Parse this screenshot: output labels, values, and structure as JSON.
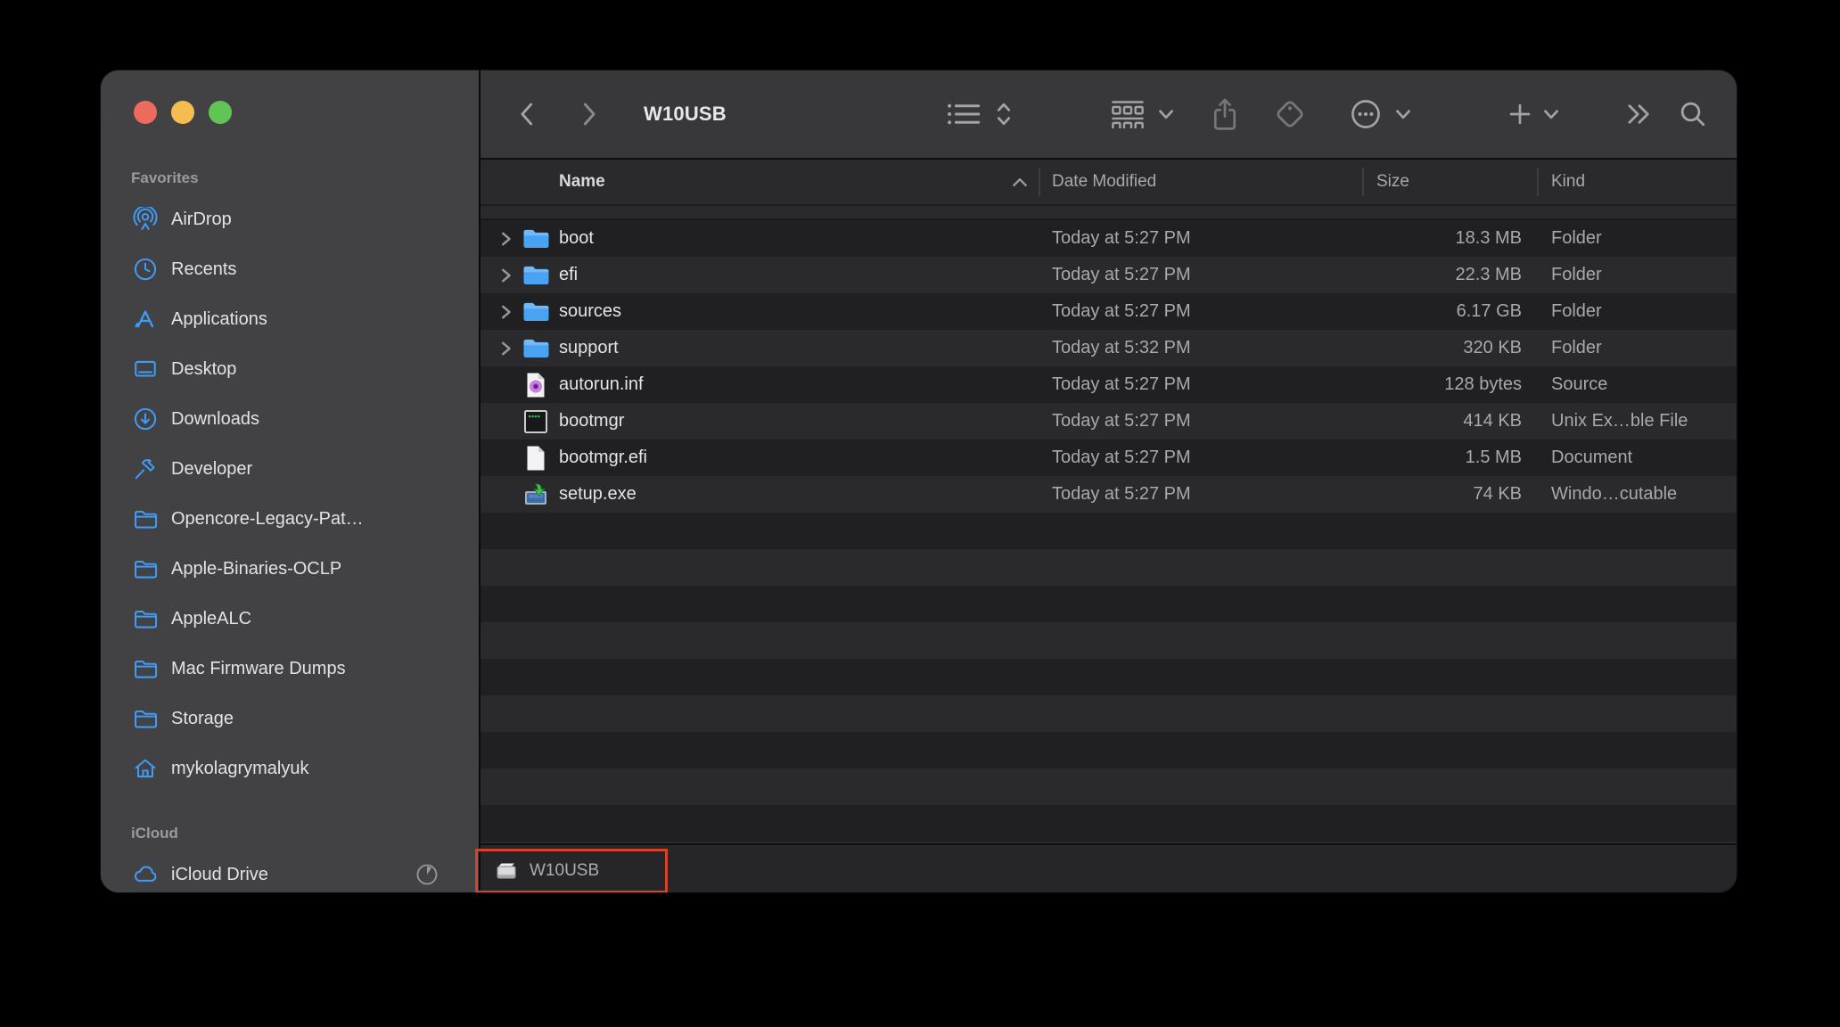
{
  "colors": {
    "accent_blue": "#3F9BF5",
    "annotation_red": "#D2442C",
    "traffic_red": "#ED6A5E",
    "traffic_yellow": "#F5BD4F",
    "traffic_green": "#61C454"
  },
  "window": {
    "title": "W10USB"
  },
  "toolbar": {
    "title": "W10USB"
  },
  "sidebar": {
    "sections": [
      {
        "label": "Favorites",
        "items": [
          {
            "label": "AirDrop",
            "icon": "airdrop"
          },
          {
            "label": "Recents",
            "icon": "clock"
          },
          {
            "label": "Applications",
            "icon": "app-store"
          },
          {
            "label": "Desktop",
            "icon": "desktop"
          },
          {
            "label": "Downloads",
            "icon": "download-circle"
          },
          {
            "label": "Developer",
            "icon": "hammer"
          },
          {
            "label": "Opencore-Legacy-Pat…",
            "icon": "folder"
          },
          {
            "label": "Apple-Binaries-OCLP",
            "icon": "folder"
          },
          {
            "label": "AppleALC",
            "icon": "folder"
          },
          {
            "label": "Mac Firmware Dumps",
            "icon": "folder"
          },
          {
            "label": "Storage",
            "icon": "folder"
          },
          {
            "label": "mykolagrymalyuk",
            "icon": "home"
          }
        ]
      },
      {
        "label": "iCloud",
        "items": [
          {
            "label": "iCloud Drive",
            "icon": "cloud",
            "trailing": "sync-progress"
          }
        ]
      }
    ]
  },
  "table": {
    "sort_column": "Name",
    "sort_direction": "ascending",
    "columns": [
      "Name",
      "Date Modified",
      "Size",
      "Kind"
    ],
    "rows": [
      {
        "name": "boot",
        "icon": "folder",
        "expandable": true,
        "date": "Today at 5:27 PM",
        "size": "18.3 MB",
        "kind": "Folder"
      },
      {
        "name": "efi",
        "icon": "folder",
        "expandable": true,
        "date": "Today at 5:27 PM",
        "size": "22.3 MB",
        "kind": "Folder"
      },
      {
        "name": "sources",
        "icon": "folder",
        "expandable": true,
        "date": "Today at 5:27 PM",
        "size": "6.17 GB",
        "kind": "Folder"
      },
      {
        "name": "support",
        "icon": "folder",
        "expandable": true,
        "date": "Today at 5:32 PM",
        "size": "320 KB",
        "kind": "Folder"
      },
      {
        "name": "autorun.inf",
        "icon": "source-document",
        "expandable": false,
        "date": "Today at 5:27 PM",
        "size": "128 bytes",
        "kind": "Source"
      },
      {
        "name": "bootmgr",
        "icon": "unix-executable",
        "expandable": false,
        "date": "Today at 5:27 PM",
        "size": "414 KB",
        "kind": "Unix Ex…ble File"
      },
      {
        "name": "bootmgr.efi",
        "icon": "document",
        "expandable": false,
        "date": "Today at 5:27 PM",
        "size": "1.5 MB",
        "kind": "Document"
      },
      {
        "name": "setup.exe",
        "icon": "windows-installer",
        "expandable": false,
        "date": "Today at 5:27 PM",
        "size": "74 KB",
        "kind": "Windo…cutable"
      }
    ]
  },
  "statusbar": {
    "items": [
      {
        "label": "W10USB",
        "icon": "disk",
        "highlighted": true
      }
    ]
  }
}
